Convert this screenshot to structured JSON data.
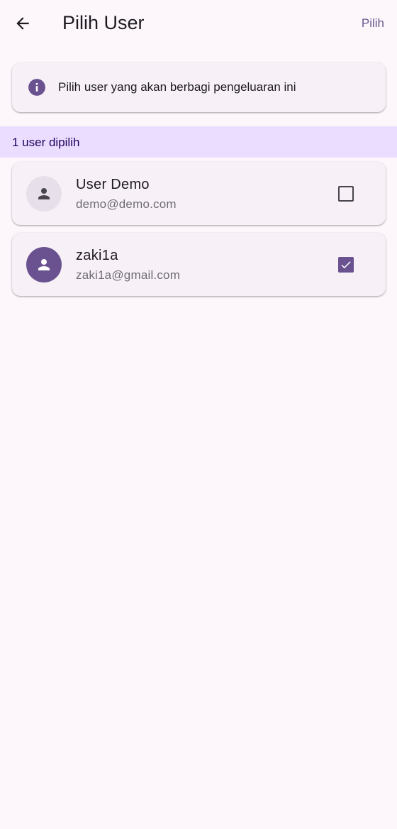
{
  "appbar": {
    "title": "Pilih User",
    "back_icon": "arrow-back-icon",
    "action_label": "Pilih"
  },
  "info": {
    "icon": "info-icon",
    "text": "Pilih user yang akan berbagi pengeluaran ini"
  },
  "selection": {
    "summary": "1 user dipilih"
  },
  "users": [
    {
      "name": "User Demo",
      "email": "demo@demo.com",
      "checked": false,
      "avatar_icon": "person-icon"
    },
    {
      "name": "zaki1a",
      "email": "zaki1a@gmail.com",
      "checked": true,
      "avatar_icon": "person-icon"
    }
  ],
  "colors": {
    "background": "#fdf7fc",
    "primary": "#6a5190",
    "selected_bar": "#eaddff",
    "card": "#f7f1f7"
  }
}
